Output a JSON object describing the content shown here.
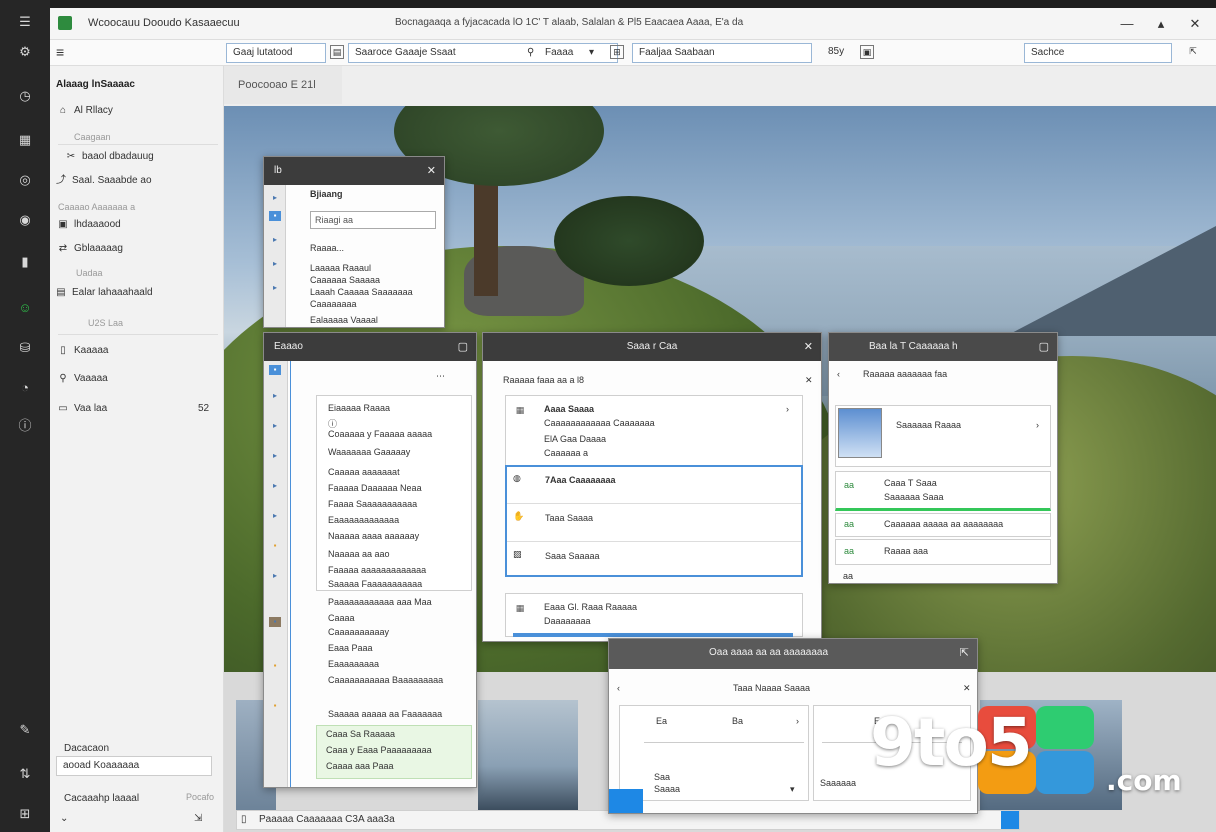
{
  "colors": {
    "accent": "#2e8b3e",
    "selection": "#4a90d9",
    "success": "#34c759",
    "rail": "#262626"
  },
  "rail": {
    "icons": [
      "app-icon",
      "settings-icon",
      "clock-icon",
      "calendar-icon",
      "globe-icon",
      "target-icon",
      "door-icon",
      "person-icon",
      "database-icon",
      "chart-icon",
      "info-icon",
      "pin-icon",
      "tune-icon",
      "grid-icon"
    ]
  },
  "titlebar": {
    "app_title": "Wcoocauu Dooudo Kasaaecuu",
    "window_title": "Bocnagaaqa a fyjacacada lO 1C' T alaab, Salalan & Pl5 Eaacaea Aaaa, E'a da",
    "minimize": "—",
    "restore": "▴",
    "close": "✕"
  },
  "toolbar": {
    "field1": "Gaaj lutatood",
    "field2_text": "Saaroce Gaaaje Ssaat",
    "field3_text": "Faaaa",
    "field4": "Faaljaa Saabaan",
    "zoom": "85y",
    "search_placeholder": "Sachce"
  },
  "sidebar": {
    "title": "Alaaag lnSaaaac",
    "items": [
      {
        "icon": "⌂",
        "label": "Al Rllacy",
        "kind": "item"
      },
      {
        "icon": "",
        "label": "Caagaan",
        "kind": "sub"
      },
      {
        "icon": "✂",
        "label": "baaol dbadauug",
        "kind": "item"
      },
      {
        "icon": "⤴",
        "label": "Saal. Saaabde ao",
        "kind": "item"
      },
      {
        "icon": "",
        "label": "Caaaao Aaaaaaa   a",
        "kind": "sub"
      },
      {
        "icon": "▣",
        "label": "lhdaaaood",
        "kind": "item"
      },
      {
        "icon": "⇄",
        "label": "Gblaaaaag",
        "kind": "item"
      },
      {
        "icon": "",
        "label": "Uadaa",
        "kind": "sub"
      },
      {
        "icon": "▤",
        "label": "Ealar lahaaahaald",
        "kind": "item"
      },
      {
        "icon": "",
        "label": "U2S Laa",
        "kind": "sub"
      },
      {
        "icon": "▯",
        "label": "Kaaaaa",
        "kind": "item"
      },
      {
        "icon": "⚲",
        "label": "Vaaaaa",
        "kind": "item"
      },
      {
        "icon": "▭",
        "label": "Vaa laa",
        "kind": "item"
      }
    ],
    "count_badge": "52",
    "footer_label": "Dacacaon",
    "footer_input": "aooad Koaaaaaa",
    "footer_link": "Cacaaahp laaaal",
    "footer_meta": "Pocafo"
  },
  "breadcrumb": "Poocooao  E  21l",
  "dialog_a": {
    "title": "lb",
    "heading": "Bjiaang",
    "field": "Riaagi  aa",
    "items": [
      "Raaaa...",
      "Laaaaa Raaaul",
      "Caaaaaa Saaaaa",
      "Laaah Caaaaa Saaaaaaa",
      "Caaaaaaaa"
    ],
    "footer": "Ealaaaaa Vaaaal"
  },
  "dialog_b": {
    "title": "Eaaao",
    "list": [
      "Eiaaaaa Raaaa",
      "Coaaaaa y Faaaaa aaaaa",
      "Waaaaaaa Gaaaaay",
      "Caaaaa aaaaaaat",
      "Faaaaa Daaaaaa Neaa",
      "Faaaa Saaaaaaaaaaa",
      "Eaaaaaaaaaaaaa",
      "Naaaaa aaaa aaaaaay",
      "Naaaaa aa aao",
      "Faaaaa aaaaaaaaaaaaa",
      "Saaaaa Faaaaaaaaaaa",
      "Paaaaaaaaaaaa aaa Maa",
      "Caaaa",
      "Caaaaaaaaaay",
      "Eaaa Paaa",
      "Eaaaaaaaaa",
      "Caaaaaaaaaaa Baaaaaaaaa",
      "Saaaaa aaaaa aa Faaaaaaa"
    ],
    "selected": [
      "Caaa Sa Raaaaa",
      "Caaa y Eaaa Paaaaaaaaa",
      "Caaaa aaa Paaa"
    ]
  },
  "dialog_c": {
    "title": "Saaa  r Caa",
    "subtitle": "Raaaaa faaa aa a l8",
    "cards": [
      {
        "icon": "▦",
        "title": "Aaaa Saaaa",
        "lines": [
          "Caaaaaaaaaaaa Caaaaaaa",
          "ElA Gaa Daaaa",
          "Caaaaaa a"
        ]
      },
      {
        "icon": "◍",
        "title": "7Aaa Caaaaaaaa",
        "lines": []
      },
      {
        "icon": "✋",
        "title": "Taaa Saaaa",
        "lines": []
      },
      {
        "icon": "▨",
        "title": "Saaa Saaaaa",
        "lines": []
      },
      {
        "icon": "▦",
        "title": "Eaaa Gl. Raaa Raaaaa",
        "lines": [
          "Daaaaaaaa"
        ]
      }
    ]
  },
  "dialog_d": {
    "title": "Baa  la T Caaaaaa  h",
    "subtitle": "Raaaaa aaaaaaa faa",
    "cards": [
      {
        "title": "Saaaaaa Raaaa",
        "lines": []
      },
      {
        "title": "Caaa T Saaa",
        "lines": [
          "Saaaaaa Saaa"
        ]
      },
      {
        "title": "Caaaaaa aaaaa aa aaaaaaaa",
        "lines": []
      },
      {
        "title": "Raaaa aaa",
        "lines": []
      }
    ],
    "tags": [
      "aa",
      "aa",
      "aa",
      "aa"
    ]
  },
  "dialog_e": {
    "title": "Oaa aaaa aa  aa aaaaaaaa",
    "heading": "Taaa Naaaa Saaaa",
    "cells": [
      "Ea",
      "Ba",
      "Ea"
    ],
    "footer_left": "Saa",
    "footer_sub": "Saaaa",
    "footer_right": "Saaaaaa"
  },
  "status_bar": "Paaaaa  Caaaaaaa  C3A  aaa3a",
  "watermark": {
    "text": "9to5",
    "suffix": ".com",
    "colors": [
      "#e84c3d",
      "#f39c12",
      "#2ecc71",
      "#3498db"
    ]
  }
}
